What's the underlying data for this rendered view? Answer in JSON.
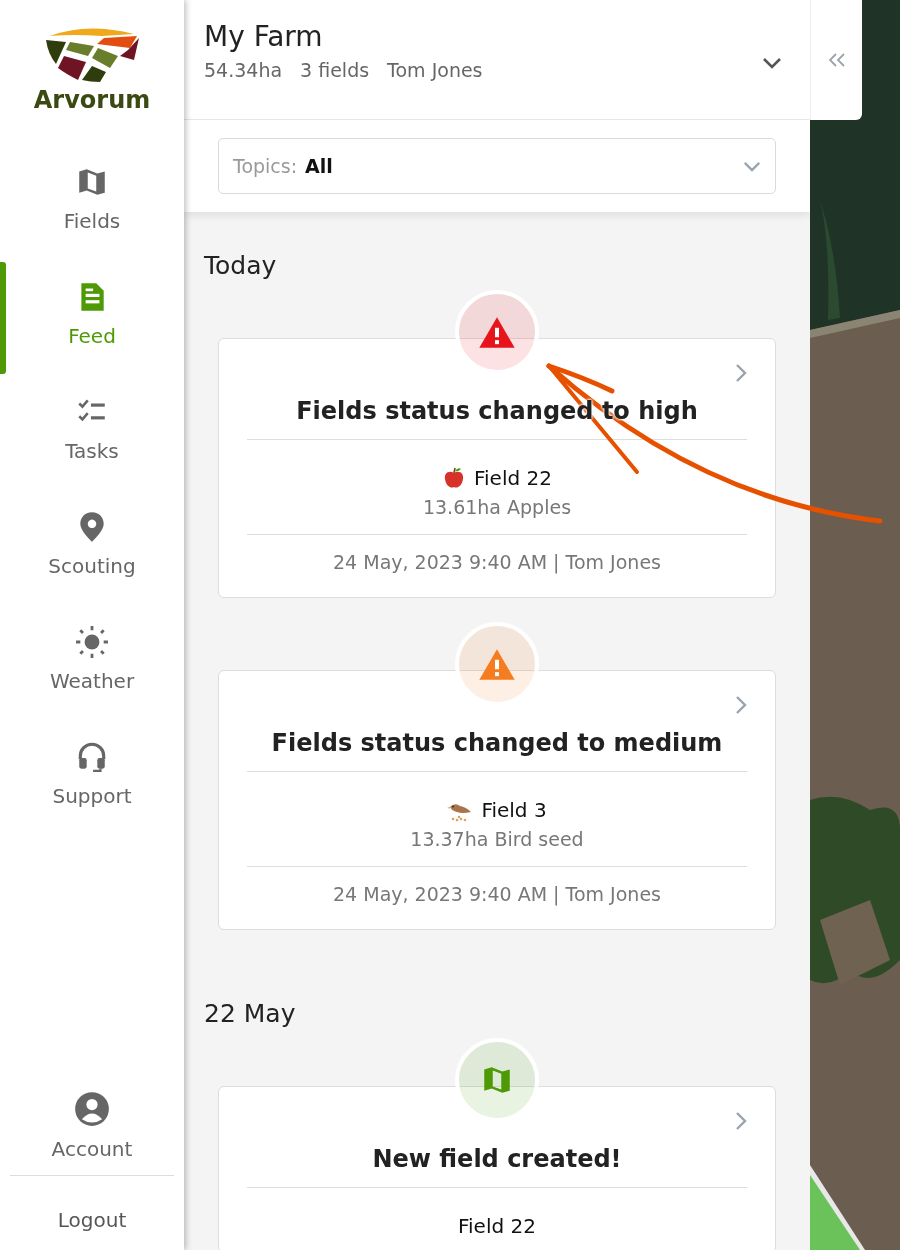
{
  "brand": {
    "name": "Arvorum"
  },
  "nav": [
    {
      "kind": "fields",
      "label": "Fields",
      "selected": false
    },
    {
      "kind": "feed",
      "label": "Feed",
      "selected": true
    },
    {
      "kind": "tasks",
      "label": "Tasks",
      "selected": false
    },
    {
      "kind": "scouting",
      "label": "Scouting",
      "selected": false
    },
    {
      "kind": "weather",
      "label": "Weather",
      "selected": false
    },
    {
      "kind": "support",
      "label": "Support",
      "selected": false
    }
  ],
  "account": {
    "label": "Account"
  },
  "logout": {
    "label": "Logout"
  },
  "farm": {
    "name": "My Farm",
    "area": "54.34ha",
    "fields": "3 fields",
    "owner": "Tom Jones"
  },
  "topics": {
    "label": "Topics:",
    "value": "All"
  },
  "groups": [
    {
      "heading": "Today",
      "events": [
        {
          "kind": "warning",
          "color": "#e8141c",
          "title": "Fields status changed to high",
          "field": {
            "kind": "apple",
            "name": "Field 22",
            "detail": "13.61ha Apples"
          },
          "meta": "24 May, 2023 9:40 AM | Tom Jones"
        },
        {
          "kind": "warning",
          "color": "#f57c1f",
          "title": "Fields status changed to medium",
          "field": {
            "kind": "bird",
            "name": "Field 3",
            "detail": "13.37ha Bird seed"
          },
          "meta": "24 May, 2023 9:40 AM | Tom Jones"
        }
      ]
    },
    {
      "heading": "22 May",
      "events": [
        {
          "kind": "field",
          "color": "#4e9a06",
          "title": "New field created!",
          "field": {
            "name": "Field 22"
          }
        }
      ]
    }
  ]
}
